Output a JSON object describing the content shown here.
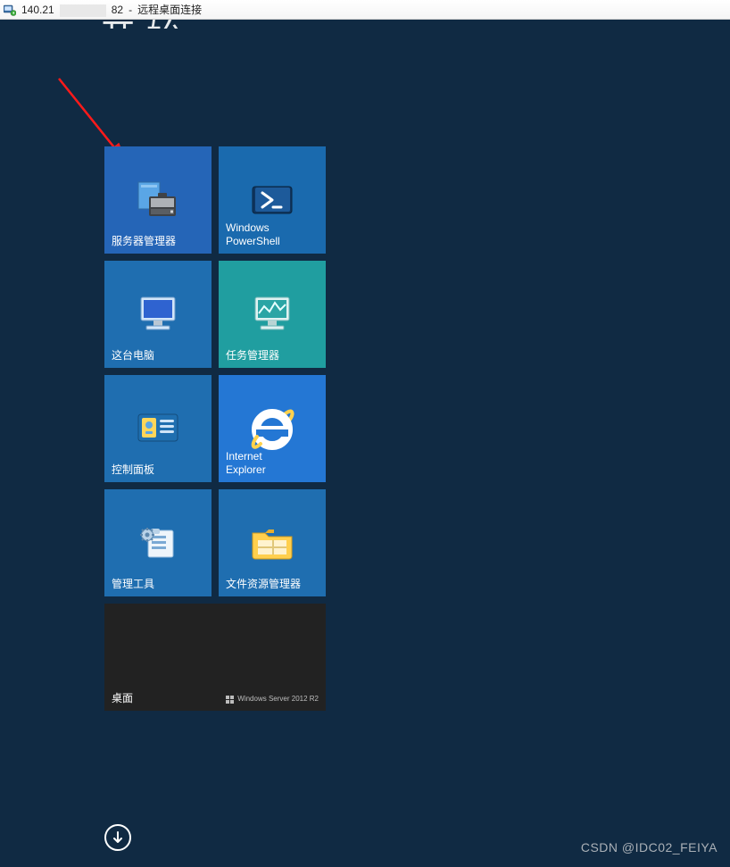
{
  "titlebar": {
    "ip_prefix": "140.21",
    "ip_suffix": "82",
    "label": "远程桌面连接"
  },
  "header": {
    "partial_title": "开始"
  },
  "tiles": {
    "server_manager": "服务器管理器",
    "powershell_line1": "Windows",
    "powershell_line2": "PowerShell",
    "this_pc": "这台电脑",
    "task_manager": "任务管理器",
    "control_panel": "控制面板",
    "ie_line1": "Internet",
    "ie_line2": "Explorer",
    "admin_tools": "管理工具",
    "file_explorer": "文件资源管理器",
    "desktop": "桌面",
    "desktop_sub": "Windows Server 2012 R2"
  },
  "watermark": "CSDN @IDC02_FEIYA"
}
